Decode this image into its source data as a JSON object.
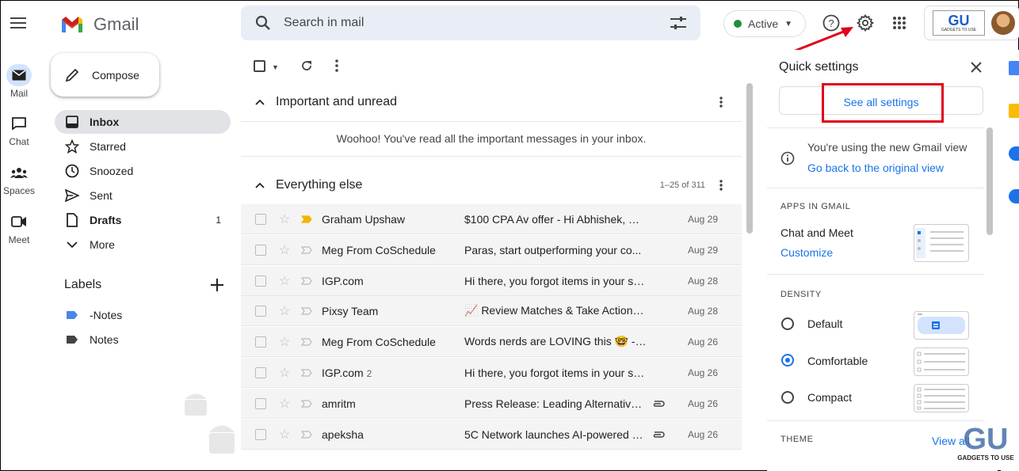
{
  "app": {
    "name": "Gmail"
  },
  "header": {
    "search_placeholder": "Search in mail",
    "status": "Active",
    "logo_text": "GU",
    "logo_sub": "GADGETS TO USE"
  },
  "rail": [
    {
      "label": "Mail",
      "icon": "mail-icon"
    },
    {
      "label": "Chat",
      "icon": "chat-icon"
    },
    {
      "label": "Spaces",
      "icon": "spaces-icon"
    },
    {
      "label": "Meet",
      "icon": "meet-icon"
    }
  ],
  "compose_label": "Compose",
  "nav": [
    {
      "label": "Inbox",
      "icon": "inbox-icon",
      "count": ""
    },
    {
      "label": "Starred",
      "icon": "star-icon",
      "count": ""
    },
    {
      "label": "Snoozed",
      "icon": "clock-icon",
      "count": ""
    },
    {
      "label": "Sent",
      "icon": "send-icon",
      "count": ""
    },
    {
      "label": "Drafts",
      "icon": "draft-icon",
      "count": "1"
    },
    {
      "label": "More",
      "icon": "chevron-down-icon",
      "count": ""
    }
  ],
  "labels": {
    "title": "Labels",
    "items": [
      {
        "label": "-Notes",
        "color": "#4a86e8"
      },
      {
        "label": "Notes",
        "color": "#444444"
      }
    ]
  },
  "sections": {
    "important": {
      "title": "Important and unread",
      "empty_message": "Woohoo! You've read all the important messages in your inbox."
    },
    "everything": {
      "title": "Everything else",
      "range": "1–25 of 311"
    }
  },
  "emails": [
    {
      "sender": "Graham Upshaw",
      "count": "",
      "subject": "$100 CPA Av offer - Hi Abhishek, Gr...",
      "date": "Aug 29",
      "important": true,
      "attachment": false
    },
    {
      "sender": "Meg From CoSchedule",
      "count": "",
      "subject": "Paras, start outperforming your co...",
      "date": "Aug 29",
      "important": false,
      "attachment": false
    },
    {
      "sender": "IGP.com",
      "count": "",
      "subject": "Hi there, you forgot items in your sh...",
      "date": "Aug 28",
      "important": false,
      "attachment": false
    },
    {
      "sender": "Pixsy Team",
      "count": "",
      "subject": "📈 Review Matches & Take Action - Y...",
      "date": "Aug 28",
      "important": false,
      "attachment": false
    },
    {
      "sender": "Meg From CoSchedule",
      "count": "",
      "subject": "Words nerds are LOVING this 🤓 - Y...",
      "date": "Aug 26",
      "important": false,
      "attachment": false
    },
    {
      "sender": "IGP.com",
      "count": "2",
      "subject": "Hi there, you forgot items in your sh...",
      "date": "Aug 26",
      "important": false,
      "attachment": false
    },
    {
      "sender": "amritm",
      "count": "",
      "subject": "Press Release: Leading Alternative I...",
      "date": "Aug 26",
      "important": false,
      "attachment": true
    },
    {
      "sender": "apeksha",
      "count": "",
      "subject": "5C Network launches AI-powered p...",
      "date": "Aug 26",
      "important": false,
      "attachment": true
    }
  ],
  "quick_settings": {
    "title": "Quick settings",
    "see_all": "See all settings",
    "new_view_text": "You're using the new Gmail view",
    "go_back": "Go back to the original view",
    "apps_caption": "APPS IN GMAIL",
    "chat_meet": "Chat and Meet",
    "customize": "Customize",
    "density_caption": "DENSITY",
    "density_options": [
      {
        "label": "Default",
        "selected": false
      },
      {
        "label": "Comfortable",
        "selected": true
      },
      {
        "label": "Compact",
        "selected": false
      }
    ],
    "theme_caption": "THEME",
    "view_all": "View all"
  },
  "watermark": {
    "text": "GU",
    "sub": "GADGETS TO USE"
  },
  "colors": {
    "accent": "#1a73e8",
    "highlight": "#e0001a",
    "important": "#f4b400"
  }
}
